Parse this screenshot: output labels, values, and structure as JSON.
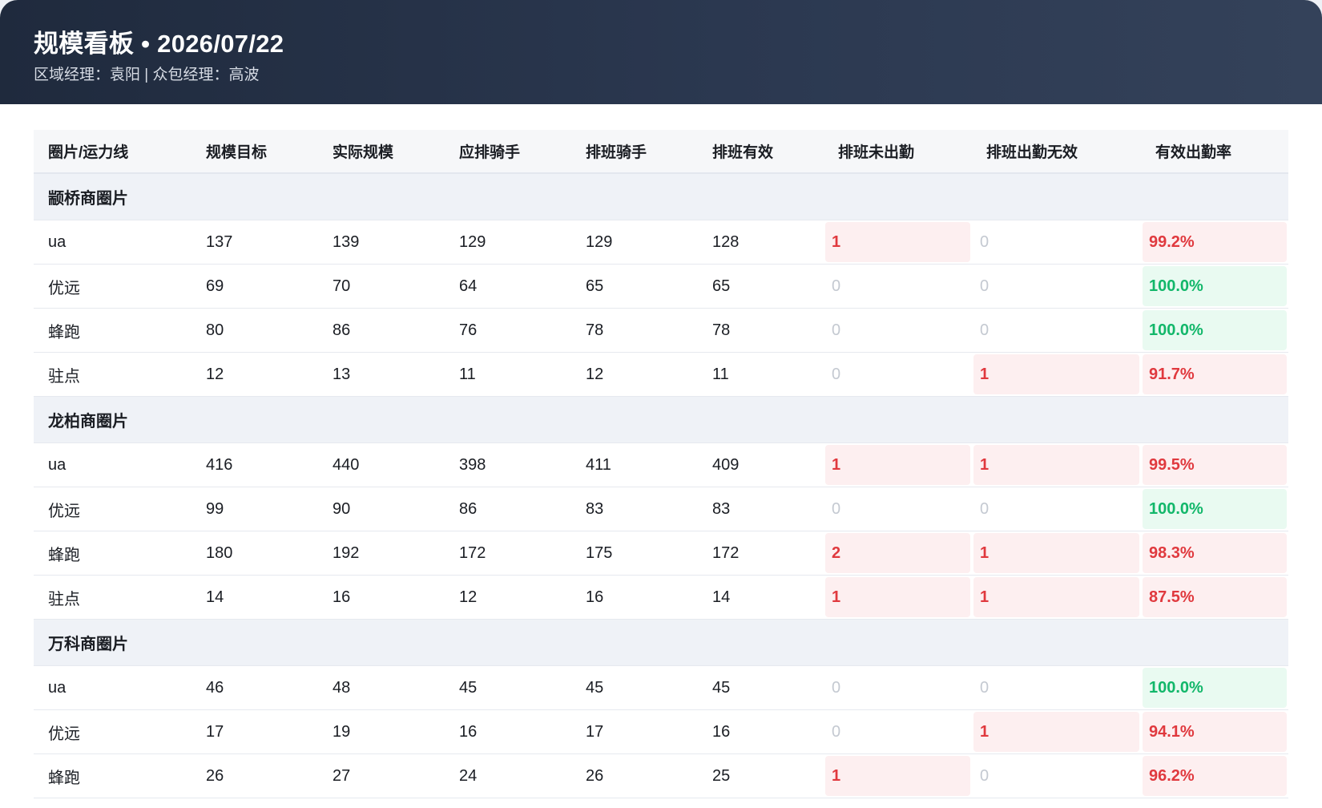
{
  "header": {
    "title": "规模看板 • 2026/07/22",
    "subtitle": "区域经理：袁阳 | 众包经理：高波"
  },
  "columns": [
    "圈片/运力线",
    "规模目标",
    "实际规模",
    "应排骑手",
    "排班骑手",
    "排班有效",
    "排班未出勤",
    "排班出勤无效",
    "有效出勤率"
  ],
  "groups": [
    {
      "name": "颛桥商圈片",
      "rows": [
        {
          "line": "ua",
          "target": "137",
          "actual": "139",
          "should": "129",
          "scheduled": "129",
          "valid": "128",
          "absent": "1",
          "invalid": "0",
          "rate": "99.2%",
          "rate_status": "bad"
        },
        {
          "line": "优远",
          "target": "69",
          "actual": "70",
          "should": "64",
          "scheduled": "65",
          "valid": "65",
          "absent": "0",
          "invalid": "0",
          "rate": "100.0%",
          "rate_status": "good"
        },
        {
          "line": "蜂跑",
          "target": "80",
          "actual": "86",
          "should": "76",
          "scheduled": "78",
          "valid": "78",
          "absent": "0",
          "invalid": "0",
          "rate": "100.0%",
          "rate_status": "good"
        },
        {
          "line": "驻点",
          "target": "12",
          "actual": "13",
          "should": "11",
          "scheduled": "12",
          "valid": "11",
          "absent": "0",
          "invalid": "1",
          "rate": "91.7%",
          "rate_status": "bad"
        }
      ]
    },
    {
      "name": "龙柏商圈片",
      "rows": [
        {
          "line": "ua",
          "target": "416",
          "actual": "440",
          "should": "398",
          "scheduled": "411",
          "valid": "409",
          "absent": "1",
          "invalid": "1",
          "rate": "99.5%",
          "rate_status": "bad"
        },
        {
          "line": "优远",
          "target": "99",
          "actual": "90",
          "should": "86",
          "scheduled": "83",
          "valid": "83",
          "absent": "0",
          "invalid": "0",
          "rate": "100.0%",
          "rate_status": "good"
        },
        {
          "line": "蜂跑",
          "target": "180",
          "actual": "192",
          "should": "172",
          "scheduled": "175",
          "valid": "172",
          "absent": "2",
          "invalid": "1",
          "rate": "98.3%",
          "rate_status": "bad"
        },
        {
          "line": "驻点",
          "target": "14",
          "actual": "16",
          "should": "12",
          "scheduled": "16",
          "valid": "14",
          "absent": "1",
          "invalid": "1",
          "rate": "87.5%",
          "rate_status": "bad"
        }
      ]
    },
    {
      "name": "万科商圈片",
      "rows": [
        {
          "line": "ua",
          "target": "46",
          "actual": "48",
          "should": "45",
          "scheduled": "45",
          "valid": "45",
          "absent": "0",
          "invalid": "0",
          "rate": "100.0%",
          "rate_status": "good"
        },
        {
          "line": "优远",
          "target": "17",
          "actual": "19",
          "should": "16",
          "scheduled": "17",
          "valid": "16",
          "absent": "0",
          "invalid": "1",
          "rate": "94.1%",
          "rate_status": "bad"
        },
        {
          "line": "蜂跑",
          "target": "26",
          "actual": "27",
          "should": "24",
          "scheduled": "26",
          "valid": "25",
          "absent": "1",
          "invalid": "0",
          "rate": "96.2%",
          "rate_status": "bad"
        }
      ]
    }
  ],
  "colors": {
    "header_dark": "#1f2a3d",
    "bad_text": "#e0393e",
    "bad_bg": "#fdeff0",
    "good_text": "#12b76a",
    "good_bg": "#e9faf1",
    "zero_text": "#c4c9d1",
    "group_bg": "#eff2f7"
  }
}
